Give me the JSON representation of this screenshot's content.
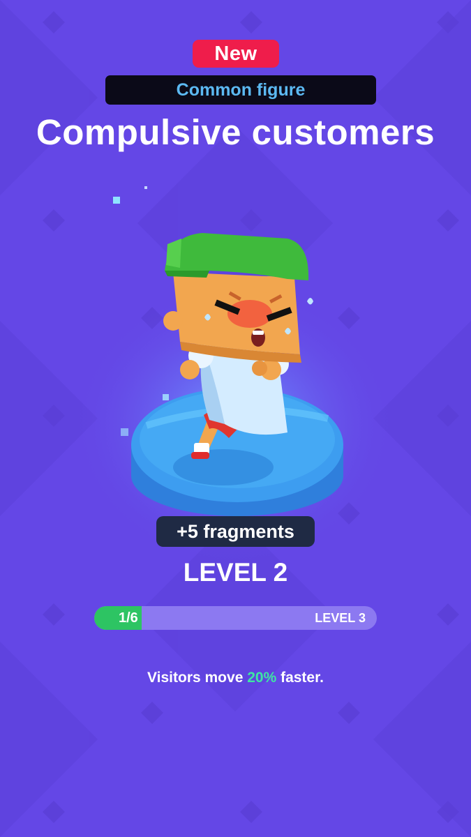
{
  "badge": {
    "label": "New"
  },
  "rarity": {
    "label": "Common figure"
  },
  "figure": {
    "name": "Compulsive customers"
  },
  "reward": {
    "fragments_label": "+5 fragments"
  },
  "level": {
    "current_label": "LEVEL 2",
    "progress_label": "1/6",
    "progress_fraction": 0.1667,
    "next_label": "LEVEL 3"
  },
  "effect": {
    "prefix": "Visitors move ",
    "highlight": "20%",
    "suffix": " faster."
  },
  "colors": {
    "background": "#6447e6",
    "badge_new": "#ef1d4b",
    "rarity_text": "#5cb9f2",
    "progress_fill": "#2dc463",
    "progress_track": "#8c79f1",
    "highlight": "#3ee6a3"
  }
}
